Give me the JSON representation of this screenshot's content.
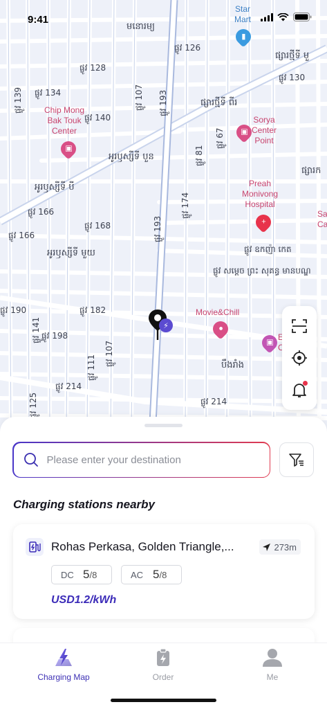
{
  "status_bar": {
    "time": "9:41"
  },
  "map": {
    "street_labels": [
      {
        "text": "មនោរម្យ",
        "cls": ""
      },
      {
        "text": "ផ្លូវ 126",
        "cls": "small"
      },
      {
        "text": "ផ្លូវ 128",
        "cls": "small"
      },
      {
        "text": "ផ្លូវ 134",
        "cls": "small"
      },
      {
        "text": "ផ្លូវ 140",
        "cls": "small"
      },
      {
        "text": "ផ្សារថ្មីទី ពីរ",
        "cls": ""
      },
      {
        "text": "អូរឫស្សីទី បួន",
        "cls": ""
      },
      {
        "text": "អូរឫស្សីទី បី",
        "cls": ""
      },
      {
        "text": "ផ្លូវ 166",
        "cls": "small"
      },
      {
        "text": "ផ្លូវ 168",
        "cls": "small"
      },
      {
        "text": "ផ្លូវ 166",
        "cls": "small"
      },
      {
        "text": "អូរឫស្សីទី មួយ",
        "cls": ""
      },
      {
        "text": "ផ្លូវ ឧកញ៉ា កេត",
        "cls": "small"
      },
      {
        "text": "ផ្លូវ សម្ដេច ព្រះ សុគន្ធ មានបណ្ឌ",
        "cls": "small"
      },
      {
        "text": "ផ្លូវ 190",
        "cls": "small"
      },
      {
        "text": "ផ្លូវ 182",
        "cls": "small"
      },
      {
        "text": "ផ្លូវ 198",
        "cls": "small"
      },
      {
        "text": "បឹងរាំង",
        "cls": ""
      },
      {
        "text": "ផ្លូវ 214",
        "cls": "small"
      },
      {
        "text": "ផ្លូវ 214",
        "cls": "small"
      },
      {
        "text": "ផ្លូវ 130",
        "cls": "small"
      },
      {
        "text": "ផ្សារថ្មីទី មួ",
        "cls": ""
      },
      {
        "text": "ផ្សារក",
        "cls": ""
      },
      {
        "text": "ផ្លូវ 193",
        "cls": "small"
      },
      {
        "text": "ផ្លូវ 193",
        "cls": "small"
      },
      {
        "text": "ផ្លូវ 107",
        "cls": "small"
      },
      {
        "text": "ផ្លូវ 139",
        "cls": "small"
      },
      {
        "text": "ផ្លូវ 174",
        "cls": "small"
      },
      {
        "text": "ផ្លូវ 81",
        "cls": "small"
      },
      {
        "text": "ផ្លូវ 67",
        "cls": "small"
      },
      {
        "text": "ផ្លូវ 141",
        "cls": "small"
      },
      {
        "text": "ផ្លូវ 111",
        "cls": "small"
      },
      {
        "text": "ផ្លូវ 107",
        "cls": "small"
      },
      {
        "text": "ផ្លូវ 125",
        "cls": "small"
      }
    ],
    "pois": {
      "star_mart": "Star\nMart",
      "chip_mong": "Chip Mong\nBak Touk\nCenter",
      "sorya": "Sorya\nCenter\nPoint",
      "preah_monivong": "Preah\nMonivong\nHospital",
      "movie_chill": "Movie&Chill",
      "sa_ca": "Sa\nCa",
      "e_c": "E\nC"
    },
    "poi_colors": {
      "shop": "#d94f86",
      "hospital": "#e8334b",
      "transit": "#3b9be0"
    }
  },
  "map_tools": {
    "scan": "scan-icon",
    "locate": "locate-icon",
    "notify": "bell-icon"
  },
  "search": {
    "placeholder": "Please enter your destination"
  },
  "nearby": {
    "title": "Charging stations nearby",
    "stations": [
      {
        "name": "Rohas Perkasa, Golden Triangle,...",
        "distance": "273m",
        "dc_label": "DC",
        "dc_available": "5",
        "dc_total": "/8",
        "ac_label": "AC",
        "ac_available": "5",
        "ac_total": "/8",
        "price": "USD1.2/kWh"
      }
    ]
  },
  "tabs": [
    {
      "label": "Charging Map",
      "icon": "charging-map-icon",
      "active": true
    },
    {
      "label": "Order",
      "icon": "order-icon",
      "active": false
    },
    {
      "label": "Me",
      "icon": "person-icon",
      "active": false
    }
  ],
  "colors": {
    "accent": "#3e31b5",
    "accent_gradient_end": "#e13a50",
    "map_bg": "#eef1f9",
    "road": "#ffffff",
    "major_road": "#b9c7e6"
  }
}
